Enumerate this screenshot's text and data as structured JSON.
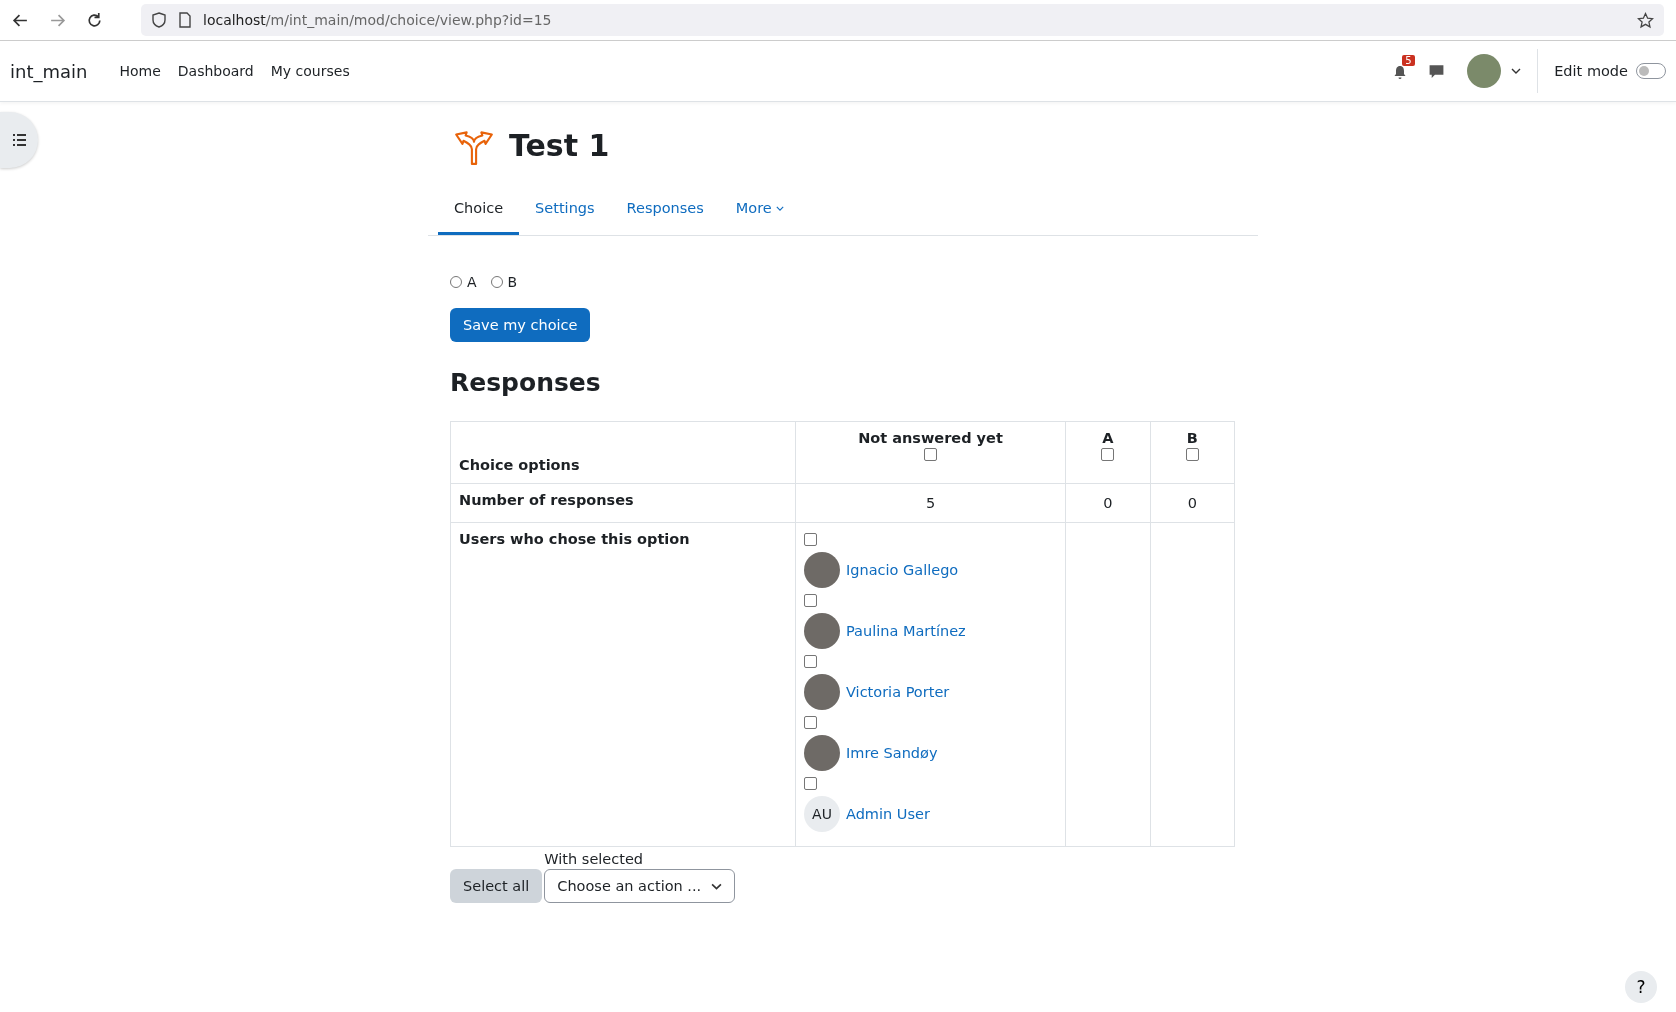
{
  "browser": {
    "url_host": "localhost",
    "url_path": "/m/int_main/mod/choice/view.php?id=15"
  },
  "navbar": {
    "site_name": "int_main",
    "links": [
      {
        "label": "Home"
      },
      {
        "label": "Dashboard"
      },
      {
        "label": "My courses"
      }
    ],
    "notification_count": "5",
    "edit_mode": {
      "label": "Edit mode",
      "on": false
    }
  },
  "page": {
    "title": "Test 1"
  },
  "tabs": [
    {
      "label": "Choice",
      "selected": true
    },
    {
      "label": "Settings",
      "selected": false
    },
    {
      "label": "Responses",
      "selected": false
    },
    {
      "label": "More",
      "selected": false,
      "kind": "dropdown"
    }
  ],
  "options": [
    {
      "label": "A",
      "selected": false
    },
    {
      "label": "B",
      "selected": false
    }
  ],
  "save_button": "Save my choice",
  "responses": {
    "heading": "Responses",
    "row_labels": [
      "Choice options",
      "Number of responses",
      "Users who chose this option"
    ],
    "columns": [
      {
        "label": "Not answered yet",
        "checked": false,
        "count": "5"
      },
      {
        "label": "A",
        "checked": false,
        "count": "0"
      },
      {
        "label": "B",
        "checked": false,
        "count": "0"
      }
    ],
    "users": [
      {
        "name": "Ignacio Gallego",
        "checked": false,
        "kind": "photo"
      },
      {
        "name": "Paulina Martínez",
        "checked": false,
        "kind": "photo"
      },
      {
        "name": "Victoria Porter",
        "checked": false,
        "kind": "photo"
      },
      {
        "name": "Imre Sandøy",
        "checked": false,
        "kind": "photo"
      },
      {
        "name": "Admin User",
        "checked": false,
        "kind": "initials",
        "initials": "AU"
      }
    ]
  },
  "footer": {
    "select_all": "Select all",
    "with_selected": "With selected",
    "action_placeholder": "Choose an action ..."
  },
  "help_button": "?"
}
